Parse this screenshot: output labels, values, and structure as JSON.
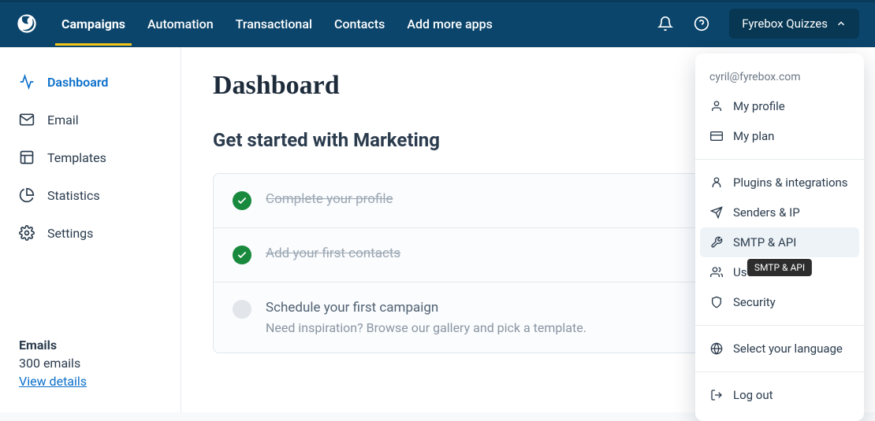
{
  "nav": {
    "items": [
      {
        "label": "Campaigns"
      },
      {
        "label": "Automation"
      },
      {
        "label": "Transactional"
      },
      {
        "label": "Contacts"
      },
      {
        "label": "Add more apps"
      }
    ]
  },
  "account": {
    "label": "Fyrebox Quizzes"
  },
  "sidebar": {
    "items": [
      {
        "label": "Dashboard"
      },
      {
        "label": "Email"
      },
      {
        "label": "Templates"
      },
      {
        "label": "Statistics"
      },
      {
        "label": "Settings"
      }
    ],
    "footer": {
      "heading": "Emails",
      "count": "300 emails",
      "link": "View details"
    }
  },
  "page": {
    "title": "Dashboard",
    "section": "Get started with Marketing",
    "tasks": [
      {
        "title": "Complete your profile",
        "done": true
      },
      {
        "title": "Add your first contacts",
        "done": true
      },
      {
        "title": "Schedule your first campaign",
        "sub": "Need inspiration? Browse our gallery and pick a template.",
        "done": false
      }
    ]
  },
  "dropdown": {
    "email": "cyril@fyrebox.com",
    "groups": [
      [
        "My profile",
        "My plan"
      ],
      [
        "Plugins & integrations",
        "Senders & IP",
        "SMTP & API",
        "Users",
        "Security"
      ],
      [
        "Select your language"
      ],
      [
        "Log out"
      ]
    ],
    "highlight": "SMTP & API",
    "tooltip": "SMTP & API"
  }
}
